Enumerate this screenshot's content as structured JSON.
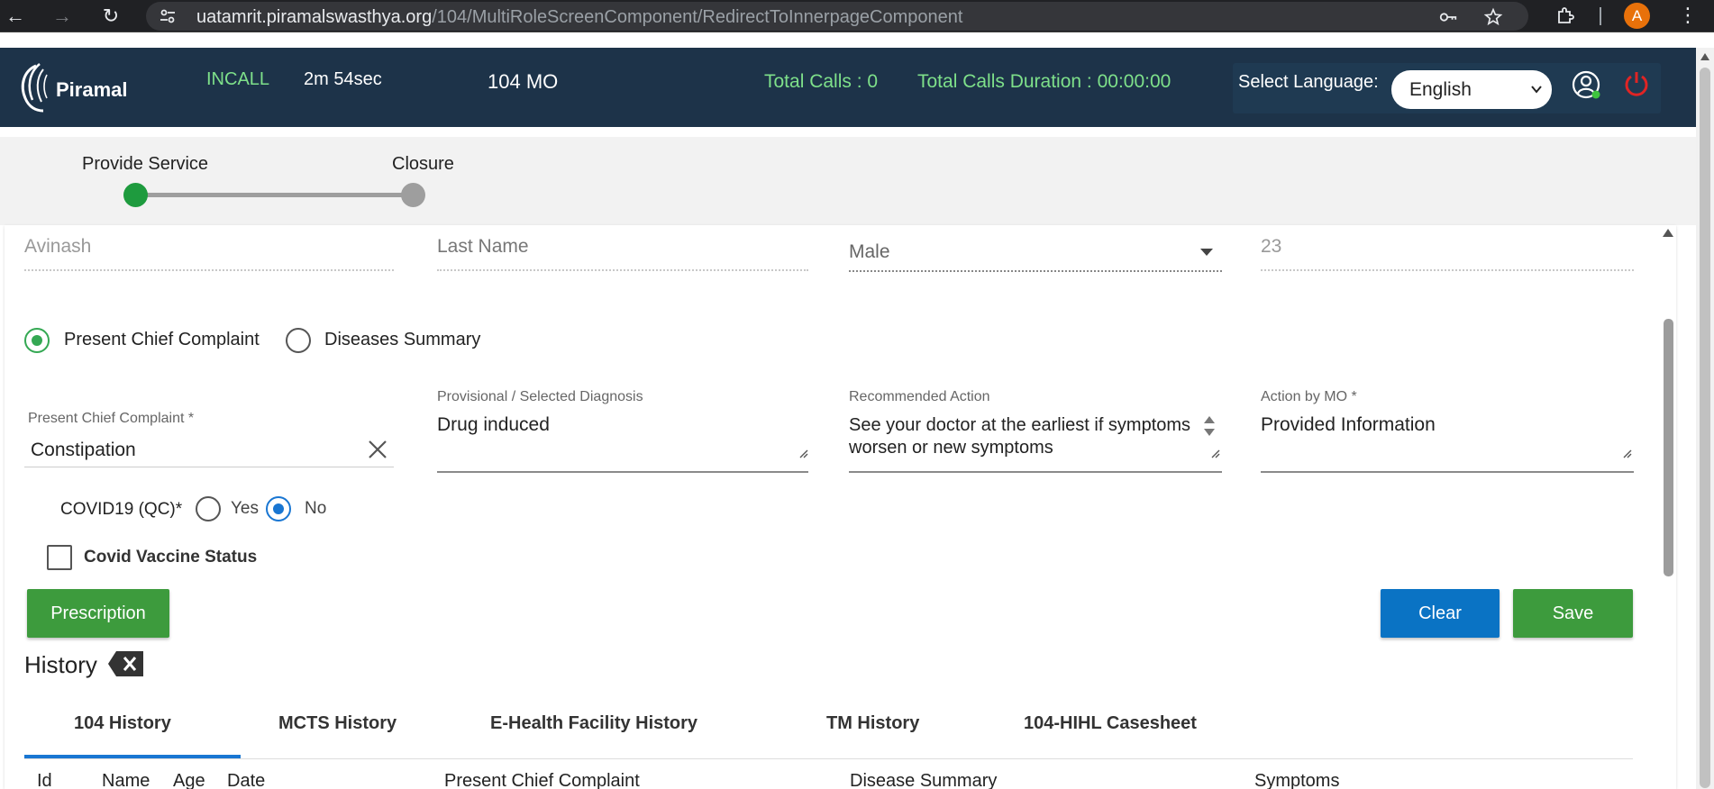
{
  "browser": {
    "url_host": "uatamrit.piramalswasthya.org",
    "url_path": "/104/MultiRoleScreenComponent/RedirectToInnerpageComponent",
    "profile_initial": "A"
  },
  "header": {
    "logo_text": "Piramal",
    "call_status": "INCALL",
    "call_timer": "2m 54sec",
    "role": "104 MO",
    "total_calls": "Total Calls : 0",
    "total_calls_duration": "Total Calls Duration : 00:00:00",
    "language_label": "Select Language:",
    "language_value": "English"
  },
  "stepper": {
    "steps": [
      "Provide Service",
      "Closure"
    ]
  },
  "patient": {
    "first_name": "Avinash",
    "last_name_placeholder": "Last Name",
    "gender": "Male",
    "age": "23"
  },
  "complaint_mode": {
    "option_present": "Present Chief Complaint",
    "option_diseases": "Diseases Summary"
  },
  "fields": {
    "chief_complaint_label": "Present Chief Complaint *",
    "chief_complaint_value": "Constipation",
    "diagnosis_label": "Provisional / Selected Diagnosis",
    "diagnosis_value": "Drug induced",
    "recommended_label": "Recommended Action",
    "recommended_value": "See your doctor at the earliest if symptoms worsen or new symptoms",
    "action_label": "Action by MO *",
    "action_value": "Provided Information"
  },
  "covid": {
    "label": "COVID19 (QC)*",
    "yes": "Yes",
    "no": "No",
    "vaccine_label": "Covid Vaccine Status"
  },
  "buttons": {
    "prescription": "Prescription",
    "clear": "Clear",
    "save": "Save"
  },
  "history": {
    "title": "History",
    "tabs": [
      "104 History",
      "MCTS History",
      "E-Health Facility History",
      "TM History",
      "104-HIHL Casesheet"
    ],
    "columns": [
      "Id",
      "Name",
      "Age",
      "Date",
      "Present Chief Complaint",
      "Disease Summary",
      "Symptoms"
    ]
  },
  "colors": {
    "header_bg": "#1d3349",
    "accent_green": "#3d9b3d",
    "accent_blue": "#0a73c4",
    "status_green": "#7ee08a"
  }
}
